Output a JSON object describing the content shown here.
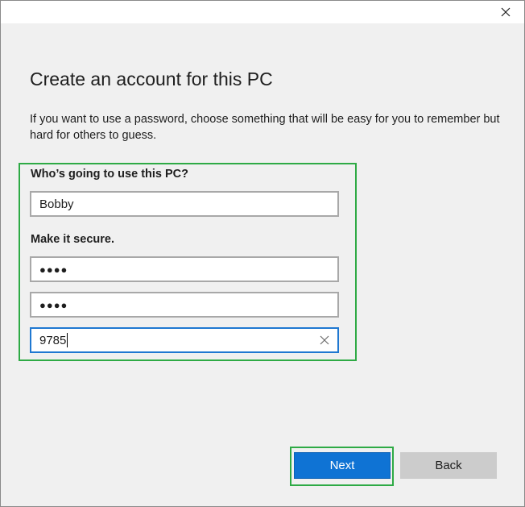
{
  "window": {
    "close_icon": "close-icon"
  },
  "page": {
    "title": "Create an account for this PC",
    "description": "If you want to use a password, choose something that will be easy for you to remember but hard for others to guess."
  },
  "form": {
    "user_label": "Who’s going to use this PC?",
    "username_value": "Bobby",
    "secure_label": "Make it secure.",
    "password_value": "●●●●",
    "password_confirm_value": "●●●●",
    "hint_value": "9785",
    "clear_icon": "clear-x-icon"
  },
  "buttons": {
    "next_label": "Next",
    "back_label": "Back"
  },
  "colors": {
    "highlight": "#2eaa45",
    "primary": "#0f73d4",
    "secondary": "#cccccc"
  }
}
